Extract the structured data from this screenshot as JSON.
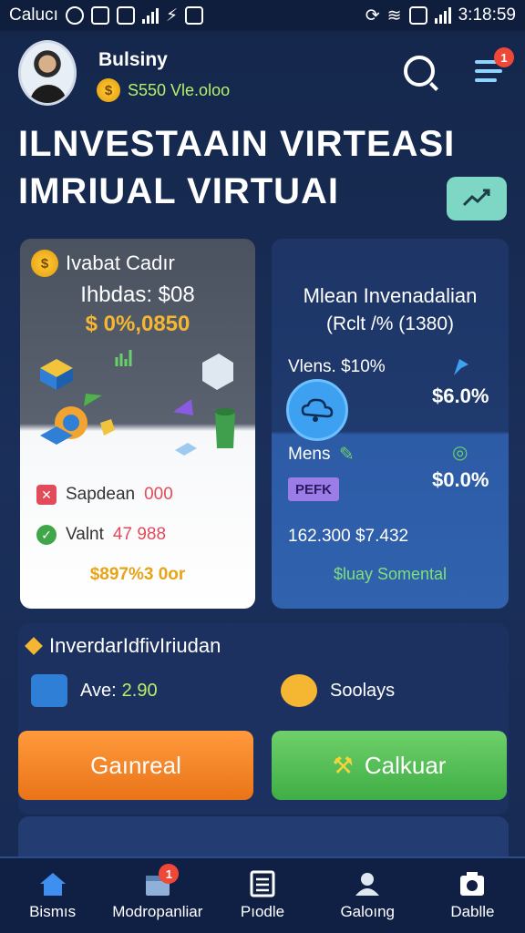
{
  "status_bar": {
    "carrier": "Calucı",
    "time": "3:18:59"
  },
  "header": {
    "username": "Bulsiny",
    "coin_symbol": "$",
    "balance": "S550 Vle.oloo",
    "notification_count": "1"
  },
  "title": {
    "line1": "ILNVESTAAIN VIRTEASI",
    "line2": "IMRIUAL VIRTUAI"
  },
  "left_card": {
    "coin_symbol": "$",
    "title": "Ivabat Cadır",
    "subtitle": "Ihbdas: $08",
    "amount": "$ 0%,0850",
    "rows": [
      {
        "label": "Sapdean",
        "value": "000",
        "icon": "x-icon",
        "color": "#e24b5a"
      },
      {
        "label": "Valnt",
        "value": "47 988",
        "icon": "check-icon",
        "color": "#3fa64a"
      }
    ],
    "total": "$897%3 0or"
  },
  "right_card": {
    "title": "Mlean Invenadalian",
    "subtitle": "(Rclt /% (1380)",
    "row1_label": "Vlens. $10%",
    "row1_value": "$6.0%",
    "row2_label": "Mens",
    "row2_value": "$0.0%",
    "badge": "PEFK",
    "figures": "162.300 $7.432",
    "total": "$luay Somental"
  },
  "section": {
    "title": "InverdarIdfivIriudan",
    "stat1_label": "Ave:",
    "stat1_value": "2.90",
    "stat2_label": "Soolays",
    "btn_primary": "Gaınreal",
    "btn_secondary": "Calkuar"
  },
  "nav": {
    "items": [
      {
        "label": "Bismıs",
        "icon": "home-icon"
      },
      {
        "label": "Modropanliar",
        "icon": "calendar-icon",
        "badge": "1"
      },
      {
        "label": "Pıodle",
        "icon": "list-icon"
      },
      {
        "label": "Galoıng",
        "icon": "user-icon"
      },
      {
        "label": "Dablle",
        "icon": "camera-icon"
      }
    ]
  },
  "colors": {
    "accent_gold": "#f5b731",
    "orange": "#ea7418",
    "green": "#3fae45",
    "navy": "#14264a"
  }
}
